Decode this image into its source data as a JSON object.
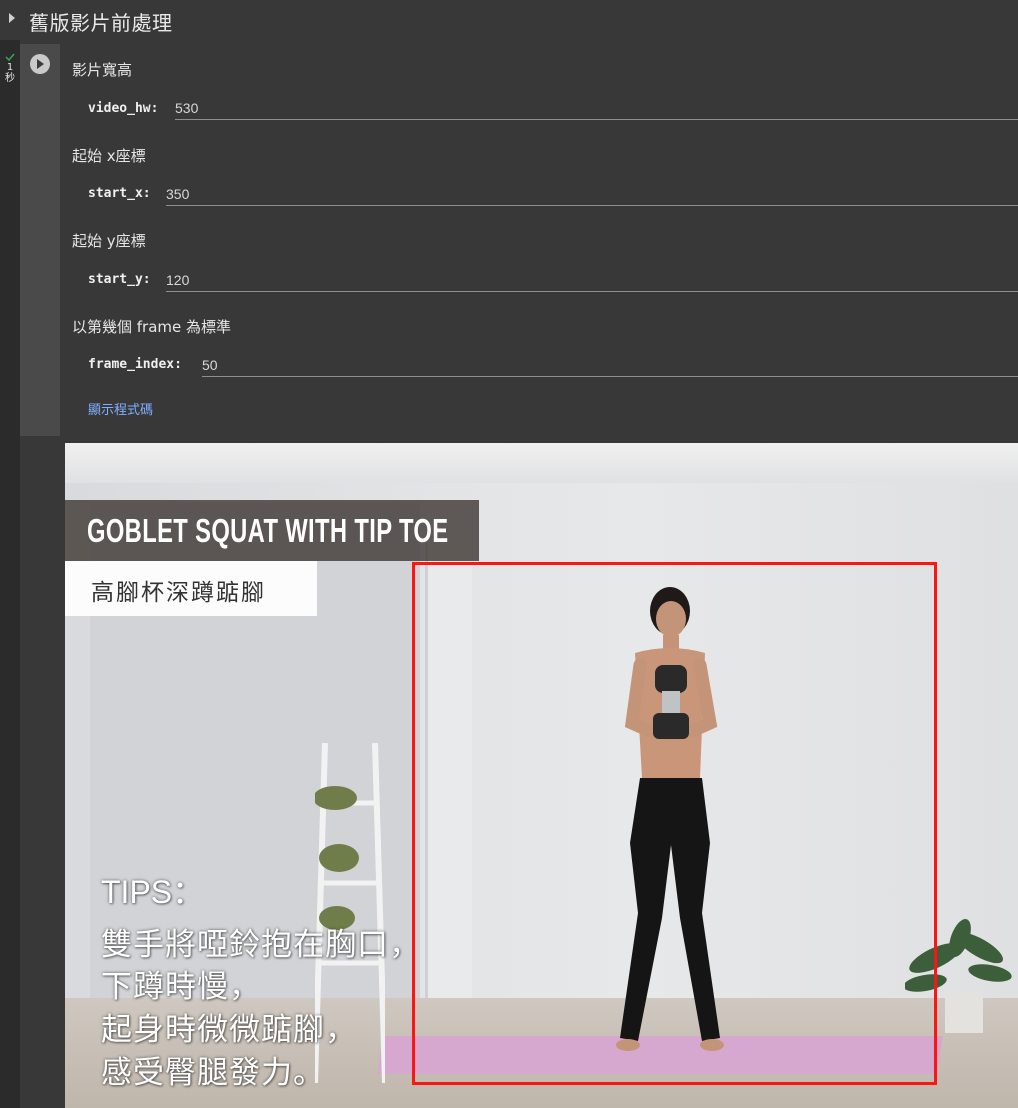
{
  "section": {
    "title": "舊版影片前處理"
  },
  "cell": {
    "exec_count": "1",
    "exec_unit": "秒"
  },
  "params": [
    {
      "label": "影片寬高",
      "name": "video_hw:",
      "value": "530"
    },
    {
      "label": "起始 x座標",
      "name": "start_x:",
      "value": "350"
    },
    {
      "label": "起始 y座標",
      "name": "start_y:",
      "value": "120"
    },
    {
      "label": "以第幾個 frame 為標準",
      "name": "frame_index:",
      "value": "50"
    }
  ],
  "show_code_label": "顯示程式碼",
  "video_frame": {
    "title": "GOBLET SQUAT WITH TIP TOE",
    "subtitle": "高腳杯深蹲踮腳",
    "tips_title": "TIPS：",
    "tips_lines": [
      "雙手將啞鈴抱在胸口，",
      "下蹲時慢，",
      "起身時微微踮腳，",
      "感受臀腿發力。"
    ],
    "bbox_color": "#ff1414"
  }
}
